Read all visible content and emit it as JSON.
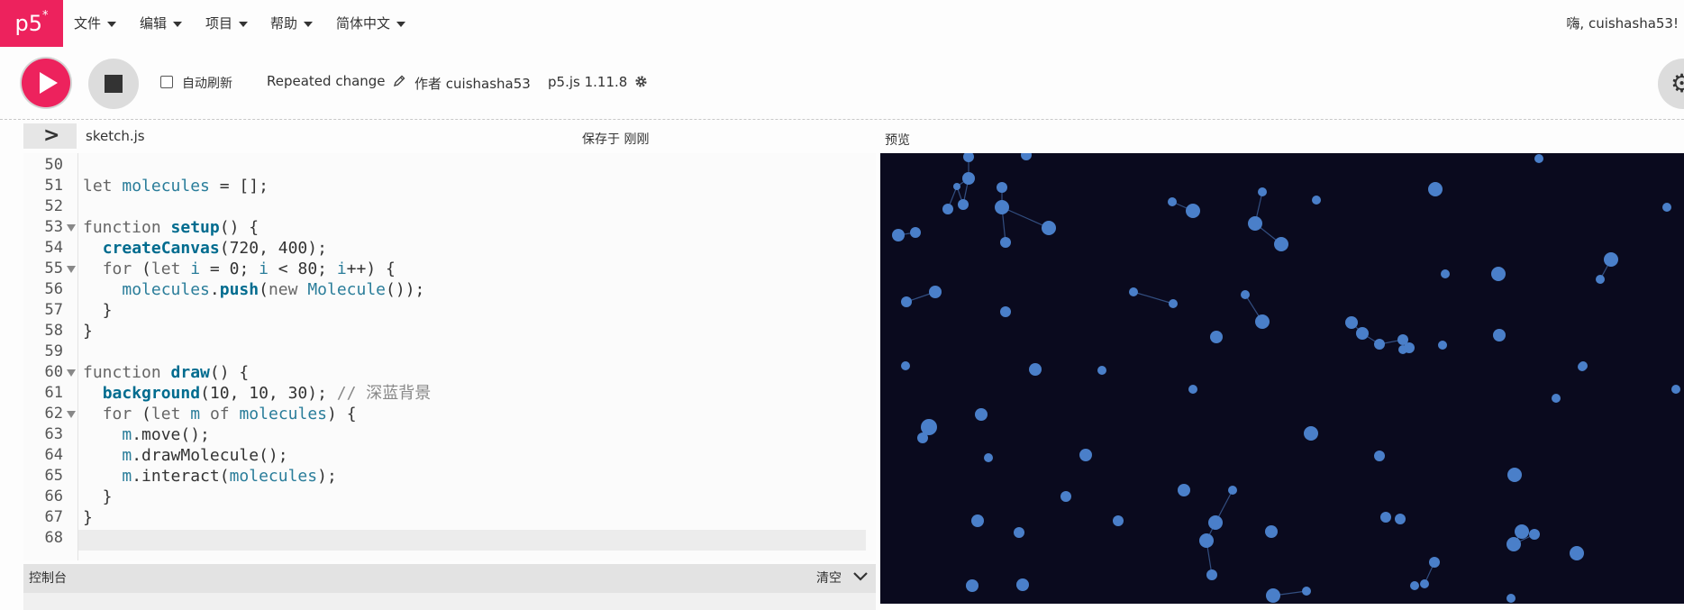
{
  "nav": {
    "logo": "p5",
    "logo_sup": "*",
    "menus": [
      {
        "label": "文件"
      },
      {
        "label": "编辑"
      },
      {
        "label": "项目"
      },
      {
        "label": "帮助"
      },
      {
        "label": "简体中文"
      }
    ],
    "greeting": "嗨, cuishasha53!"
  },
  "toolbar": {
    "auto_refresh_label": "自动刷新",
    "project_name": "Repeated change",
    "edit_icon": "pencil-icon",
    "author": "作者 cuishasha53",
    "version": "p5.js 1.11.8",
    "settings_icon": "gear-icon"
  },
  "editor": {
    "file_name": "sketch.js",
    "save_status": "保存于 刚刚",
    "lines": [
      {
        "n": "50",
        "text": ""
      },
      {
        "n": "51",
        "text": "let molecules = [];"
      },
      {
        "n": "52",
        "text": ""
      },
      {
        "n": "53",
        "text": "function setup() {"
      },
      {
        "n": "54",
        "text": "  createCanvas(720, 400);"
      },
      {
        "n": "55",
        "text": "  for (let i = 0; i < 80; i++) {"
      },
      {
        "n": "56",
        "text": "    molecules.push(new Molecule());"
      },
      {
        "n": "57",
        "text": "  }"
      },
      {
        "n": "58",
        "text": "}"
      },
      {
        "n": "59",
        "text": ""
      },
      {
        "n": "60",
        "text": "function draw() {"
      },
      {
        "n": "61",
        "text": "  background(10, 10, 30); // 深蓝背景"
      },
      {
        "n": "62",
        "text": "  for (let m of molecules) {"
      },
      {
        "n": "63",
        "text": "    m.move();"
      },
      {
        "n": "64",
        "text": "    m.drawMolecule();"
      },
      {
        "n": "65",
        "text": "    m.interact(molecules);"
      },
      {
        "n": "66",
        "text": "  }"
      },
      {
        "n": "67",
        "text": "}"
      },
      {
        "n": "68",
        "text": ""
      }
    ]
  },
  "preview": {
    "label": "预览",
    "background": "#0a0a1e",
    "dot_color": "#4a7fc9"
  },
  "console": {
    "title": "控制台",
    "clear_label": "清空"
  },
  "colors": {
    "accent": "#ed225d"
  }
}
